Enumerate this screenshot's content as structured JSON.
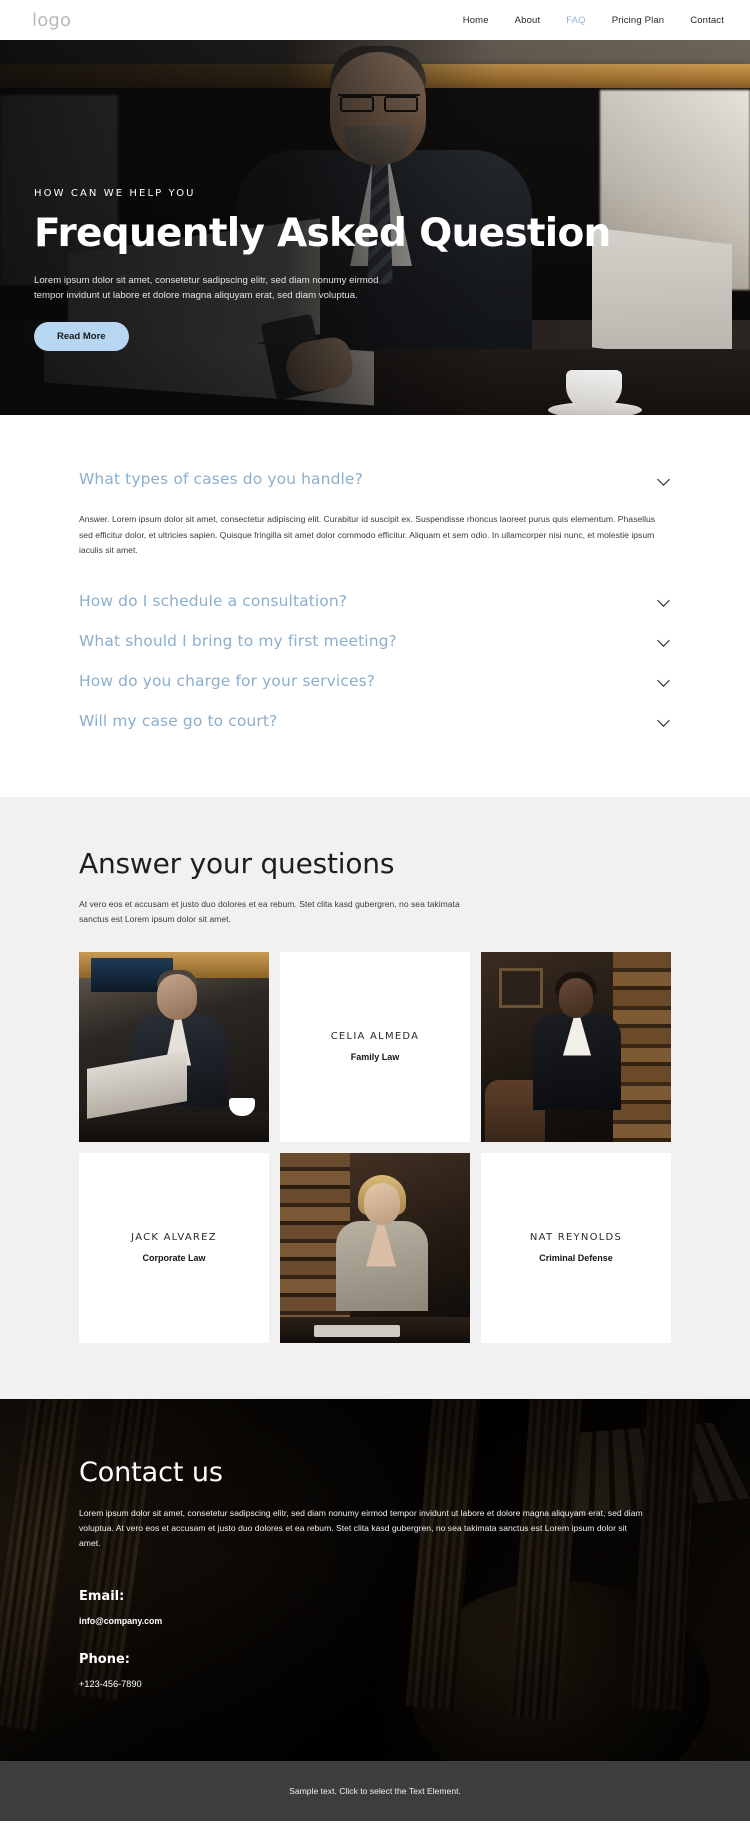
{
  "header": {
    "logo": "logo",
    "nav": [
      {
        "label": "Home",
        "active": false
      },
      {
        "label": "About",
        "active": false
      },
      {
        "label": "FAQ",
        "active": true
      },
      {
        "label": "Pricing Plan",
        "active": false
      },
      {
        "label": "Contact",
        "active": false
      }
    ]
  },
  "hero": {
    "eyebrow": "HOW CAN WE HELP YOU",
    "title": "Frequently Asked Question",
    "subtitle": "Lorem ipsum dolor sit amet, consetetur sadipscing elitr, sed diam nonumy eirmod tempor invidunt ut labore et dolore magna aliquyam erat, sed diam voluptua.",
    "cta_label": "Read More",
    "cta_color": "#b6d6f2"
  },
  "faq": {
    "accent_color": "#8aafd0",
    "items": [
      {
        "question": "What types of cases do you handle?",
        "expanded": true,
        "answer": "Answer. Lorem ipsum dolor sit amet, consectetur adipiscing elit. Curabitur id suscipit ex. Suspendisse rhoncus laoreet purus quis elementum. Phasellus sed efficitur dolor, et ultricies sapien. Quisque fringilla sit amet dolor commodo efficitur. Aliquam et sem odio. In ullamcorper nisi nunc, et molestie ipsum iaculis sit amet."
      },
      {
        "question": "How do I schedule a consultation?",
        "expanded": false,
        "answer": ""
      },
      {
        "question": "What should I bring to my first meeting?",
        "expanded": false,
        "answer": ""
      },
      {
        "question": "How do you charge for your services?",
        "expanded": false,
        "answer": ""
      },
      {
        "question": "Will my case go to court?",
        "expanded": false,
        "answer": ""
      }
    ]
  },
  "team": {
    "title": "Answer your questions",
    "intro": "At vero eos et accusam et justo duo dolores et ea rebum. Stet clita kasd gubergren, no sea takimata sanctus est Lorem ipsum dolor sit amet.",
    "members": [
      {
        "name": "CELIA ALMEDA",
        "role": "Family Law"
      },
      {
        "name": "JACK ALVAREZ",
        "role": "Corporate Law"
      },
      {
        "name": "NAT REYNOLDS",
        "role": "Criminal Defense"
      }
    ]
  },
  "contact": {
    "title": "Contact us",
    "body": "Lorem ipsum dolor sit amet, consetetur sadipscing elitr, sed diam nonumy eirmod tempor invidunt ut labore et dolore magna aliquyam erat, sed diam voluptua. At vero eos et accusam et justo duo dolores et ea rebum. Stet clita kasd gubergren, no sea takimata sanctus est Lorem ipsum dolor sit amet.",
    "email_label": "Email:",
    "email_value": "info@company.com",
    "phone_label": "Phone:",
    "phone_value": "+123-456-7890"
  },
  "footer": {
    "text": "Sample text. Click to select the Text Element."
  }
}
